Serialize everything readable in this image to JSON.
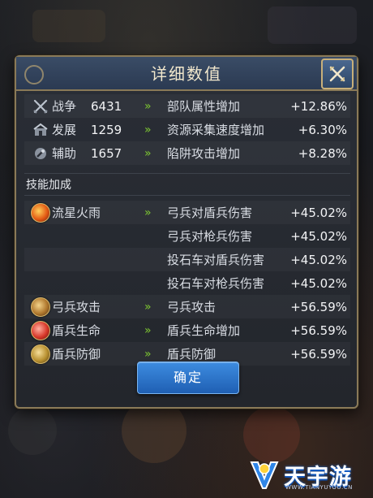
{
  "dialog": {
    "title": "详细数值",
    "stats": [
      {
        "icon": "sword-icon",
        "label": "战争",
        "value": "6431",
        "effect": "部队属性增加",
        "bonus": "+12.86%"
      },
      {
        "icon": "develop-icon",
        "label": "发展",
        "value": "1259",
        "effect": "资源采集速度增加",
        "bonus": "+6.30%"
      },
      {
        "icon": "assist-icon",
        "label": "辅助",
        "value": "1657",
        "effect": "陷阱攻击增加",
        "bonus": "+8.28%"
      }
    ],
    "skills_header": "技能加成",
    "skills": [
      {
        "icon": "meteor-icon",
        "name": "流星火雨",
        "effect": "弓兵对盾兵伤害",
        "bonus": "+45.02%"
      },
      {
        "icon": "",
        "name": "",
        "effect": "弓兵对枪兵伤害",
        "bonus": "+45.02%"
      },
      {
        "icon": "",
        "name": "",
        "effect": "投石车对盾兵伤害",
        "bonus": "+45.02%"
      },
      {
        "icon": "",
        "name": "",
        "effect": "投石车对枪兵伤害",
        "bonus": "+45.02%"
      },
      {
        "icon": "archer-attack-icon",
        "name": "弓兵攻击",
        "effect": "弓兵攻击",
        "bonus": "+56.59%"
      },
      {
        "icon": "shield-life-icon",
        "name": "盾兵生命",
        "effect": "盾兵生命增加",
        "bonus": "+56.59%"
      },
      {
        "icon": "shield-defense-icon",
        "name": "盾兵防御",
        "effect": "盾兵防御",
        "bonus": "+56.59%"
      }
    ],
    "arrow_glyph": "»",
    "confirm_label": "确定"
  },
  "watermark": {
    "text": "天宇游",
    "url": "WWW.TIANYUYOU.CN"
  },
  "colors": {
    "accent_green": "#7ec832",
    "button_blue": "#2b74cf",
    "frame_gold": "#8a7a58"
  }
}
